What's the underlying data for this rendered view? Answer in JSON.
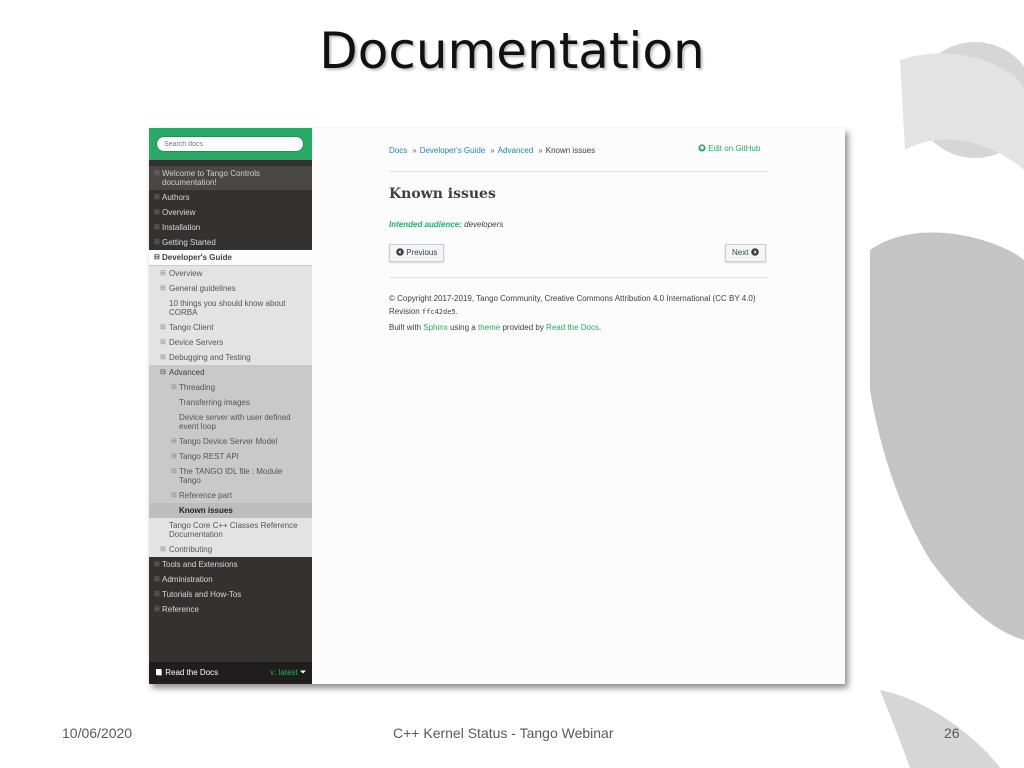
{
  "slide": {
    "title": "Documentation",
    "footer_date": "10/06/2020",
    "footer_center": "C++ Kernel Status - Tango Webinar",
    "page_number": "26"
  },
  "sidebar": {
    "search_placeholder": "Search docs",
    "items": [
      {
        "toggle": "⊞",
        "label": "Welcome to Tango Controls documentation!"
      },
      {
        "toggle": "⊞",
        "label": "Authors"
      },
      {
        "toggle": "⊞",
        "label": "Overview"
      },
      {
        "toggle": "⊞",
        "label": "Installation"
      },
      {
        "toggle": "⊞",
        "label": "Getting Started"
      },
      {
        "toggle": "⊟",
        "label": "Developer's Guide"
      },
      {
        "toggle": "⊞",
        "label": "Overview"
      },
      {
        "toggle": "⊞",
        "label": "General guidelines"
      },
      {
        "toggle": "",
        "label": "10 things you should know about CORBA"
      },
      {
        "toggle": "⊞",
        "label": "Tango Client"
      },
      {
        "toggle": "⊞",
        "label": "Device Servers"
      },
      {
        "toggle": "⊞",
        "label": "Debugging and Testing"
      },
      {
        "toggle": "⊟",
        "label": "Advanced"
      },
      {
        "toggle": "⊞",
        "label": "Threading"
      },
      {
        "toggle": "",
        "label": "Transferring images"
      },
      {
        "toggle": "",
        "label": "Device server with user defined event loop"
      },
      {
        "toggle": "⊞",
        "label": "Tango Device Server Model"
      },
      {
        "toggle": "⊞",
        "label": "Tango REST API"
      },
      {
        "toggle": "⊞",
        "label": "The TANGO IDL file : Module Tango"
      },
      {
        "toggle": "⊞",
        "label": "Reference part"
      },
      {
        "toggle": "",
        "label": "Known issues"
      },
      {
        "toggle": "",
        "label": "Tango Core C++ Classes Reference Documentation"
      },
      {
        "toggle": "⊞",
        "label": "Contributing"
      },
      {
        "toggle": "⊞",
        "label": "Tools and Extensions"
      },
      {
        "toggle": "⊞",
        "label": "Administration"
      },
      {
        "toggle": "⊞",
        "label": "Tutorials and How-Tos"
      },
      {
        "toggle": "⊞",
        "label": "Reference"
      }
    ],
    "footer_brand": "Read the Docs",
    "version": "v: latest"
  },
  "breadcrumb": {
    "items": [
      "Docs",
      "Developer's Guide",
      "Advanced",
      "Known issues"
    ],
    "separator": "»",
    "edit_link": "Edit on GitHub"
  },
  "page": {
    "heading": "Known issues",
    "audience_label": "Intended audience:",
    "audience_value": "developers",
    "prev_label": "Previous",
    "next_label": "Next",
    "copyright_line": "© Copyright 2017-2019, Tango Community, Creative Commons Attribution 4.0 International (CC BY 4.0) Revision",
    "revision": "ffc42de5",
    "built_with": "Built with",
    "sphinx": "Sphinx",
    "using_a": "using a",
    "theme": "theme",
    "provided_by": "provided by",
    "rtd": "Read the Docs"
  },
  "colors": {
    "accent_green": "#27ae60",
    "search_bar_green": "#29a966",
    "sidebar_dark": "#343131",
    "link_blue": "#2980b9"
  },
  "icons": {
    "github": "github-icon",
    "previous": "arrow-circle-left-icon",
    "next": "arrow-circle-right-icon",
    "book": "book-icon",
    "caret": "caret-down-icon"
  }
}
